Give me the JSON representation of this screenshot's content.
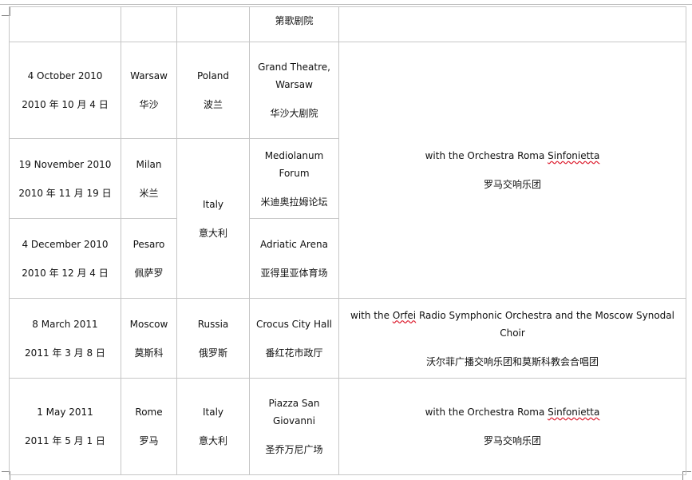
{
  "top_row": {
    "venue_zh": "第歌剧院"
  },
  "rows": [
    {
      "date_en": "4 October 2010",
      "date_zh": "2010 年 10 月 4 日",
      "city_en": "Warsaw",
      "city_zh": "华沙",
      "country_en": "Poland",
      "country_zh": "波兰",
      "venue_en": "Grand Theatre, Warsaw",
      "venue_zh": "华沙大剧院"
    },
    {
      "date_en": "19 November 2010",
      "date_zh": "2010 年 11 月 19 日",
      "city_en": "Milan",
      "city_zh": "米兰",
      "country_en": "Italy",
      "country_zh": "意大利",
      "venue_en": "Mediolanum Forum",
      "venue_zh": "米迪奥拉姆论坛"
    },
    {
      "date_en": "4 December 2010",
      "date_zh": "2010 年 12 月 4 日",
      "city_en": "Pesaro",
      "city_zh": "佩萨罗",
      "venue_en": "Adriatic Arena",
      "venue_zh": "亚得里亚体育场"
    },
    {
      "date_en": "8 March 2011",
      "date_zh": "2011 年 3 月 8 日",
      "city_en": "Moscow",
      "city_zh": "莫斯科",
      "country_en": "Russia",
      "country_zh": "俄罗斯",
      "venue_en": "Crocus City Hall",
      "venue_zh": "番红花市政厅"
    },
    {
      "date_en": "1 May 2011",
      "date_zh": "2011 年 5 月 1 日",
      "city_en": "Rome",
      "city_zh": "罗马",
      "country_en": "Italy",
      "country_zh": "意大利",
      "venue_en": "Piazza San Giovanni",
      "venue_zh": "圣乔万尼广场"
    }
  ],
  "notes": {
    "roma_pre": "with the Orchestra Roma ",
    "roma_word": "Sinfonietta",
    "roma_zh": "罗马交响乐团",
    "orfei_pre": "with the ",
    "orfei_word": "Orfei",
    "orfei_post": " Radio Symphonic Orchestra and the Moscow Synodal Choir",
    "orfei_zh": "沃尔菲广播交响乐团和莫斯科教会合唱团",
    "rome_pre": "with the Orchestra Roma ",
    "rome_word": "Sinfonietta",
    "rome_zh": "罗马交响乐团"
  }
}
